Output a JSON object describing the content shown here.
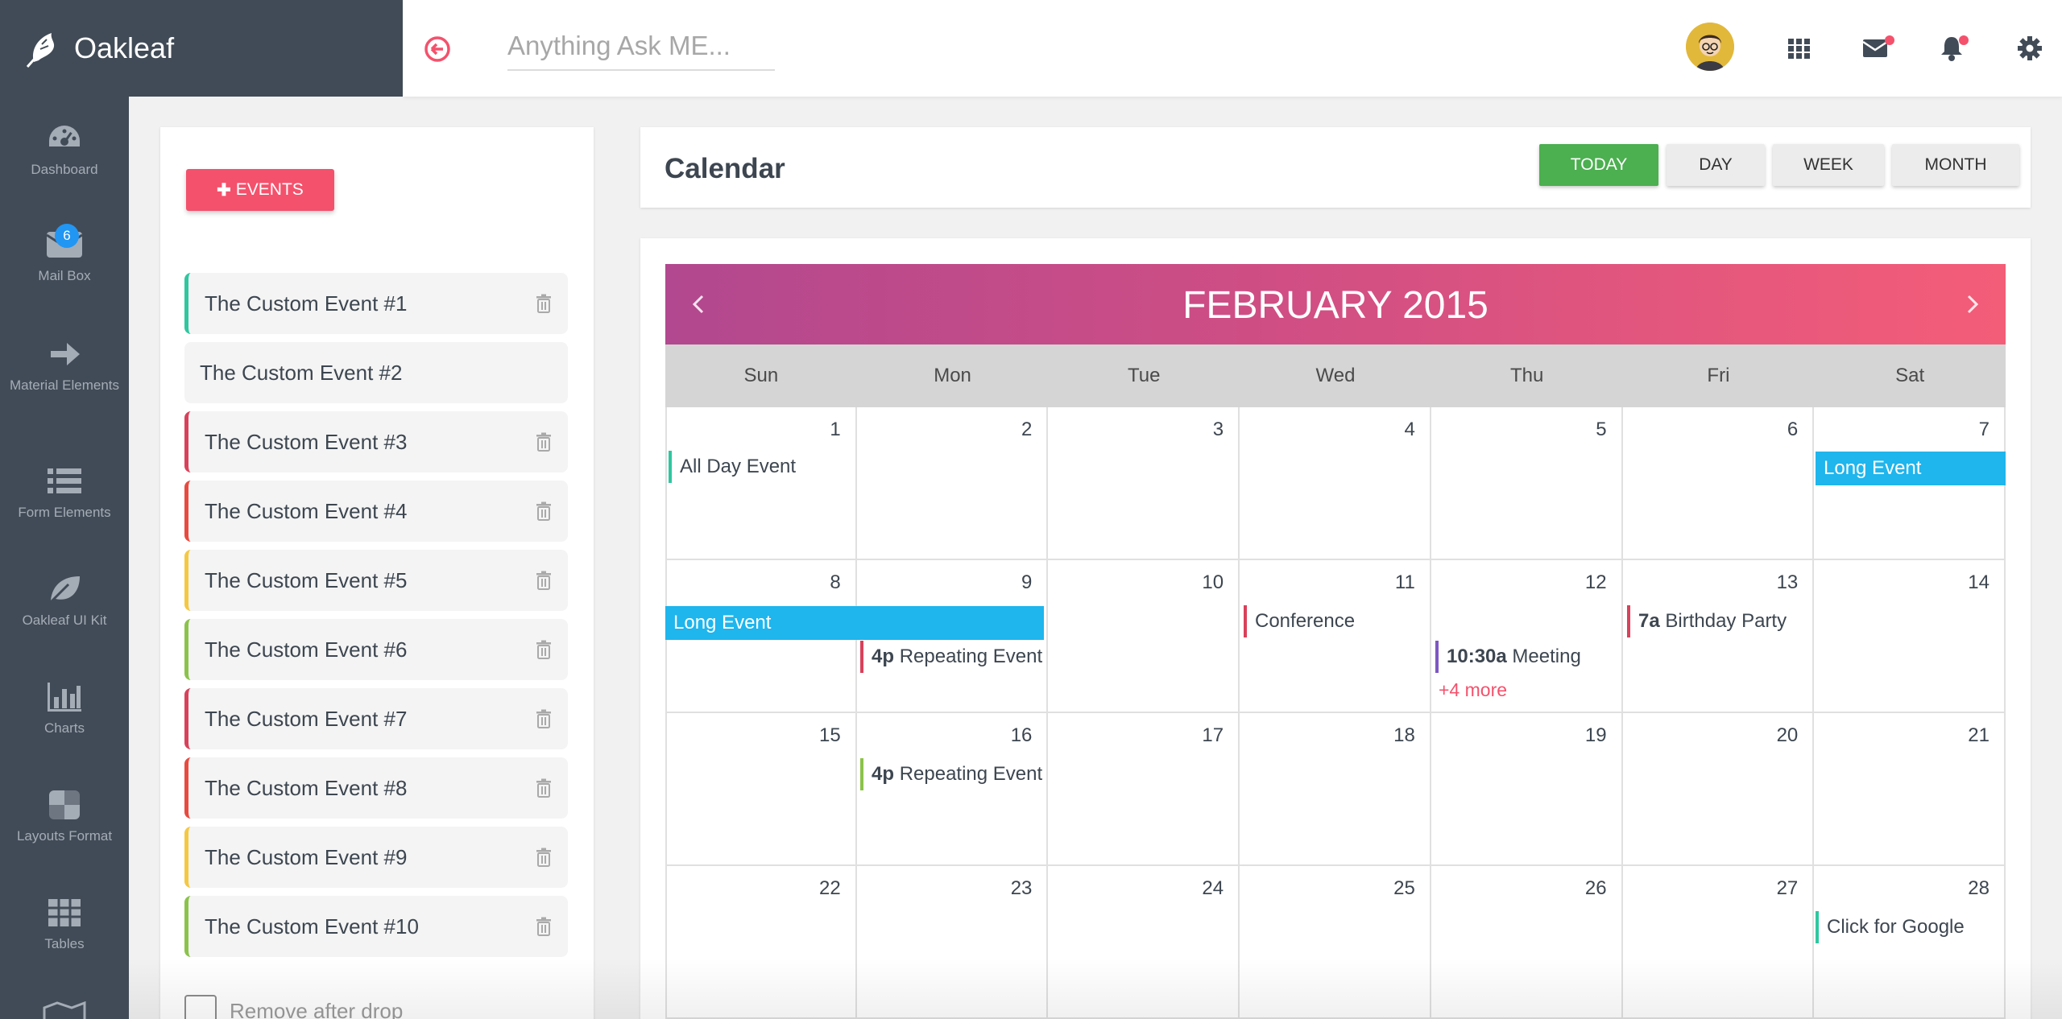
{
  "brand": {
    "name": "Oakleaf"
  },
  "sidebar": {
    "mail_badge": "6",
    "items": [
      {
        "label": "Dashboard",
        "icon": "dashboard-icon"
      },
      {
        "label": "Mail Box",
        "icon": "mail-icon"
      },
      {
        "label": "Material Elements",
        "icon": "arrow-right-icon"
      },
      {
        "label": "Form Elements",
        "icon": "list-icon"
      },
      {
        "label": "Oakleaf UI Kit",
        "icon": "leaf-icon"
      },
      {
        "label": "Charts",
        "icon": "bar-chart-icon"
      },
      {
        "label": "Layouts Format",
        "icon": "layout-icon"
      },
      {
        "label": "Tables",
        "icon": "table-icon"
      }
    ]
  },
  "topbar": {
    "search_placeholder": "Anything Ask ME...",
    "icons": [
      "back-circle-icon",
      "apps-grid-icon",
      "mail-icon",
      "bell-icon",
      "gear-icon"
    ],
    "notification_color": "#f4516c"
  },
  "events_panel": {
    "add_label": "EVENTS",
    "remove_after_drop": "Remove after drop",
    "events": [
      {
        "label": "The Custom Event #1",
        "color": "#2ec7a0"
      },
      {
        "label": "The Custom Event #2",
        "color": ""
      },
      {
        "label": "The Custom Event #3",
        "color": "#d9415a"
      },
      {
        "label": "The Custom Event #4",
        "color": "#e84a3f"
      },
      {
        "label": "The Custom Event #5",
        "color": "#f5c842"
      },
      {
        "label": "The Custom Event #6",
        "color": "#8bc34a"
      },
      {
        "label": "The Custom Event #7",
        "color": "#d9415a"
      },
      {
        "label": "The Custom Event #8",
        "color": "#e84a3f"
      },
      {
        "label": "The Custom Event #9",
        "color": "#f5c842"
      },
      {
        "label": "The Custom Event #10",
        "color": "#8bc34a"
      }
    ]
  },
  "calendar": {
    "title": "Calendar",
    "views": [
      "TODAY",
      "DAY",
      "WEEK",
      "MONTH"
    ],
    "active_view": "TODAY",
    "month": "FEBRUARY 2015",
    "weekdays": [
      "Sun",
      "Mon",
      "Tue",
      "Wed",
      "Thu",
      "Fri",
      "Sat"
    ],
    "weeks": [
      [
        "1",
        "2",
        "3",
        "4",
        "5",
        "6",
        "7"
      ],
      [
        "8",
        "9",
        "10",
        "11",
        "12",
        "13",
        "14"
      ],
      [
        "15",
        "16",
        "17",
        "18",
        "19",
        "20",
        "21"
      ],
      [
        "22",
        "23",
        "24",
        "25",
        "26",
        "27",
        "28"
      ]
    ],
    "events": {
      "all_day": "All Day Event",
      "long_event": "Long Event",
      "repeat_time": "4p",
      "repeat_title": "Repeating Event",
      "conference": "Conference",
      "meeting_time": "10:30a",
      "meeting_title": "Meeting",
      "more": "+4 more",
      "birthday_time": "7a",
      "birthday_title": "Birthday Party",
      "google": "Click for Google"
    },
    "colors": {
      "header_start": "#b2488f",
      "header_end": "#f45d78",
      "long_event": "#1fb5ed",
      "today_button": "#4caf50"
    }
  }
}
